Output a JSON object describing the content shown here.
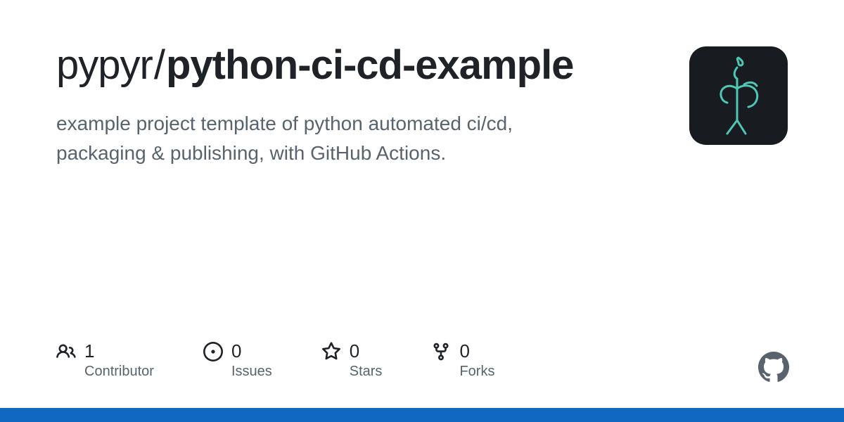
{
  "repo": {
    "owner": "pypyr",
    "name_parts": [
      "python",
      "-",
      "ci",
      "-",
      "cd",
      "-",
      "example"
    ],
    "description": "example project template of python automated ci/cd, packaging & publishing, with GitHub Actions."
  },
  "stats": {
    "contributors": {
      "value": "1",
      "label": "Contributor"
    },
    "issues": {
      "value": "0",
      "label": "Issues"
    },
    "stars": {
      "value": "0",
      "label": "Stars"
    },
    "forks": {
      "value": "0",
      "label": "Forks"
    }
  },
  "colors": {
    "accent": "#1168bf",
    "avatar_fg": "#4fc7b7"
  }
}
